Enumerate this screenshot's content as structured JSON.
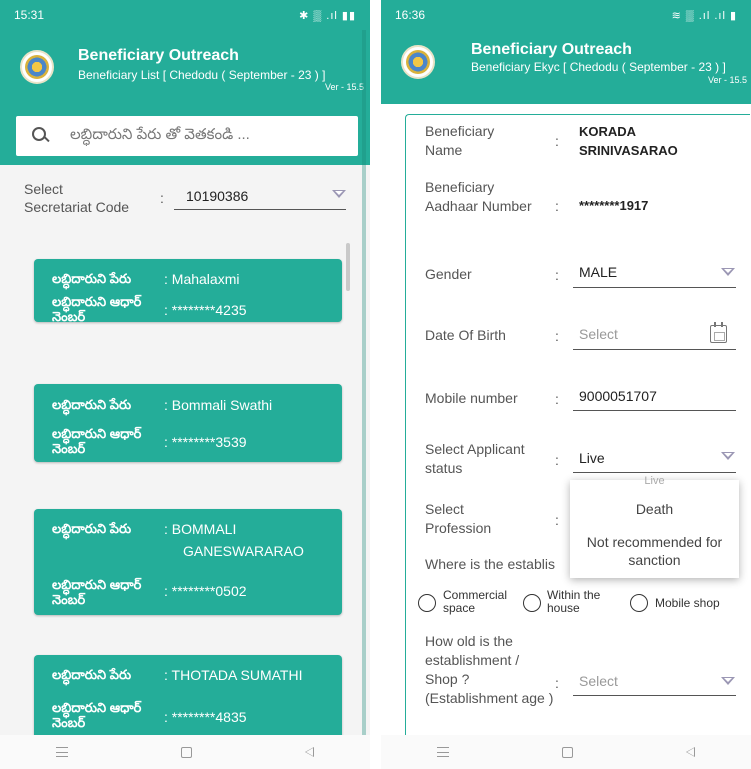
{
  "left": {
    "status_time": "15:31",
    "status_icons": "✱ ▒ .ıl ▮▮",
    "app_title": "Beneficiary Outreach",
    "app_subtitle": "Beneficiary List [  Chedodu ( September - 23 ) ]",
    "version": "Ver - 15.5",
    "search_placeholder": "లబ్ధిదారుని పేరు తో వెతకండి ...",
    "select_label": "Select Secretariat Code",
    "select_value": "10190386",
    "name_label": "లబ్ధిదారుని పేరు",
    "aadhaar_label": "లబ్ధిదారుని ఆధార్ నెంబర్",
    "cards": [
      {
        "name": ":  Mahalaxmi",
        "aadhaar": ":  ********4235"
      },
      {
        "name": ":  Bommali Swathi",
        "aadhaar": ":  ********3539"
      },
      {
        "name": ":  BOMMALI",
        "name2": "GANESWARARAO",
        "aadhaar": ":  ********0502"
      },
      {
        "name": ":  THOTADA SUMATHI",
        "aadhaar": ":  ********4835"
      }
    ]
  },
  "right": {
    "status_time": "16:36",
    "status_icons": "≋ ▒ .ıl .ıl ▮",
    "app_title": "Beneficiary Outreach",
    "app_subtitle": "Beneficiary Ekyc [  Chedodu ( September - 23 ) ]",
    "version": "Ver - 15.5",
    "fields": {
      "name_label": "Beneficiary Name",
      "name_value": "KORADA SRINIVASARAO",
      "aadhaar_label": "Beneficiary Aadhaar Number",
      "aadhaar_value": "********1917",
      "gender_label": "Gender",
      "gender_value": "MALE",
      "dob_label": "Date Of Birth",
      "dob_placeholder": "Select",
      "mobile_label": "Mobile number",
      "mobile_value": "9000051707",
      "status_label": "Select Applicant status",
      "status_value": "Live",
      "profession_label": "Select Profession",
      "establishment_question": "Where is the establis",
      "radio_options": [
        "Commercial space",
        "Within the house",
        "Mobile shop"
      ],
      "age_label": "How old is the establishment / Shop ? (Establishment age )",
      "age_placeholder": "Select"
    },
    "dropdown": {
      "partial": "Live",
      "options": [
        "Death",
        "Not recommended for sanction"
      ]
    }
  },
  "colors": {
    "primary": "#24ad99",
    "dropdown_arrow": "#9b97b4"
  },
  "icons": [
    "search-icon",
    "dropdown-arrow-icon",
    "calendar-icon",
    "nav-menu-icon",
    "nav-home-icon",
    "nav-back-icon",
    "logo-icon"
  ]
}
